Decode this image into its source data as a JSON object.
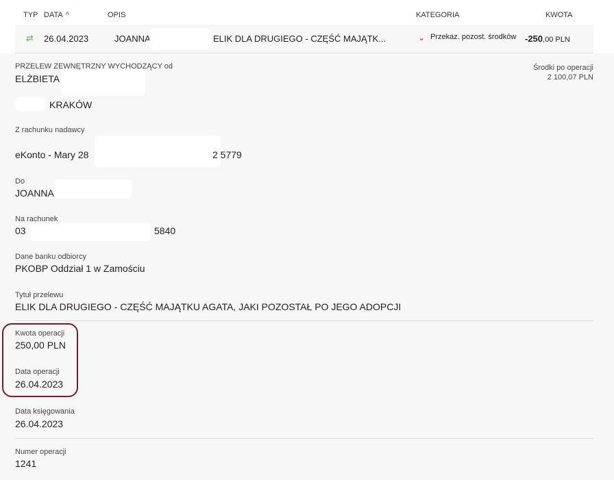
{
  "header": {
    "typ": "TYP",
    "data": "DATA",
    "sort_icon": "chevron-up-icon",
    "opis": "OPIS",
    "kategoria": "KATEGORIA",
    "kwota": "KWOTA"
  },
  "row": {
    "type_icon": "transfer-arrows-icon",
    "date": "26.04.2023",
    "name": "JOANNA",
    "title": "ELIK DLA DRUGIEGO - CZĘŚĆ MAJĄTK...",
    "category": "Przekaz. pozost. środków",
    "amount_main": "-250",
    "amount_rest": ",00 PLN"
  },
  "details": {
    "type_label": "PRZELEW ZEWNĘTRZNY WYCHODZĄCY od",
    "sender_name": "ELŻBIETA",
    "sender_city": "KRAKÓW",
    "balance_label": "Środki po operacji",
    "balance_value": "2 100,07 PLN",
    "from_account_label": "Z rachunku nadawcy",
    "from_account_prefix": "eKonto - Mary 28",
    "from_account_suffix": "2 5779",
    "to_label": "Do",
    "to_name": "JOANNA",
    "to_account_label": "Na rachunek",
    "to_account_prefix": "03",
    "to_account_suffix": "5840",
    "bank_label": "Dane banku odbiorcy",
    "bank_value": "PKOBP Oddział 1 w Zamościu",
    "transfer_title_label": "Tytuł przelewu",
    "transfer_title_value": "ELIK DLA DRUGIEGO - CZĘŚĆ MAJĄTKU AGATA, JAKI POZOSTAŁ PO JEGO ADOPCJI",
    "amount_label": "Kwota operacji",
    "amount_value": "250,00 PLN",
    "op_date_label": "Data operacji",
    "op_date_value": "26.04.2023",
    "booking_date_label": "Data księgowania",
    "booking_date_value": "26.04.2023",
    "op_number_label": "Numer operacji",
    "op_number_value": "1241"
  },
  "colors": {
    "accent_red": "#d32027",
    "highlight_border": "#7a1a2e",
    "transfer_green": "#5cb85c"
  }
}
